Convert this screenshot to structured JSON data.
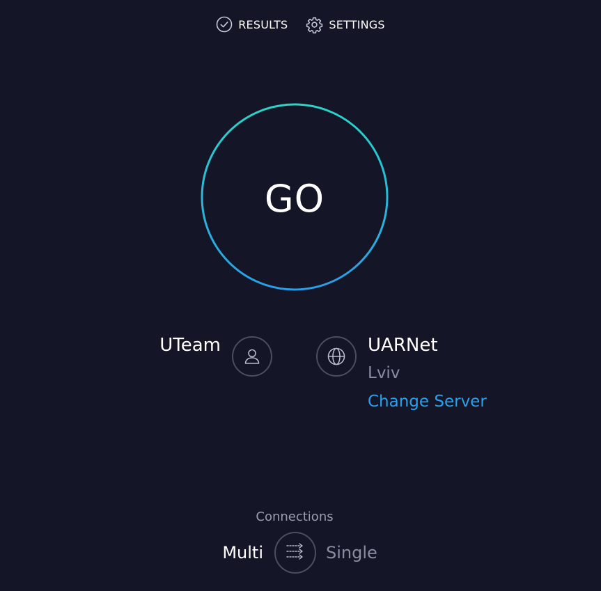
{
  "nav": {
    "results_label": "RESULTS",
    "settings_label": "SETTINGS"
  },
  "go": {
    "label": "GO",
    "ring_gradient": [
      "#2ad4c8",
      "#2a9ee6"
    ]
  },
  "host": {
    "name": "UTeam"
  },
  "server": {
    "name": "UARNet",
    "city": "Lviv",
    "change_label": "Change Server"
  },
  "connections": {
    "title": "Connections",
    "multi_label": "Multi",
    "single_label": "Single",
    "selected": "Multi"
  },
  "colors": {
    "background": "#141526",
    "accent_link": "#2aa1ed",
    "muted_text": "#8b8ca1"
  }
}
